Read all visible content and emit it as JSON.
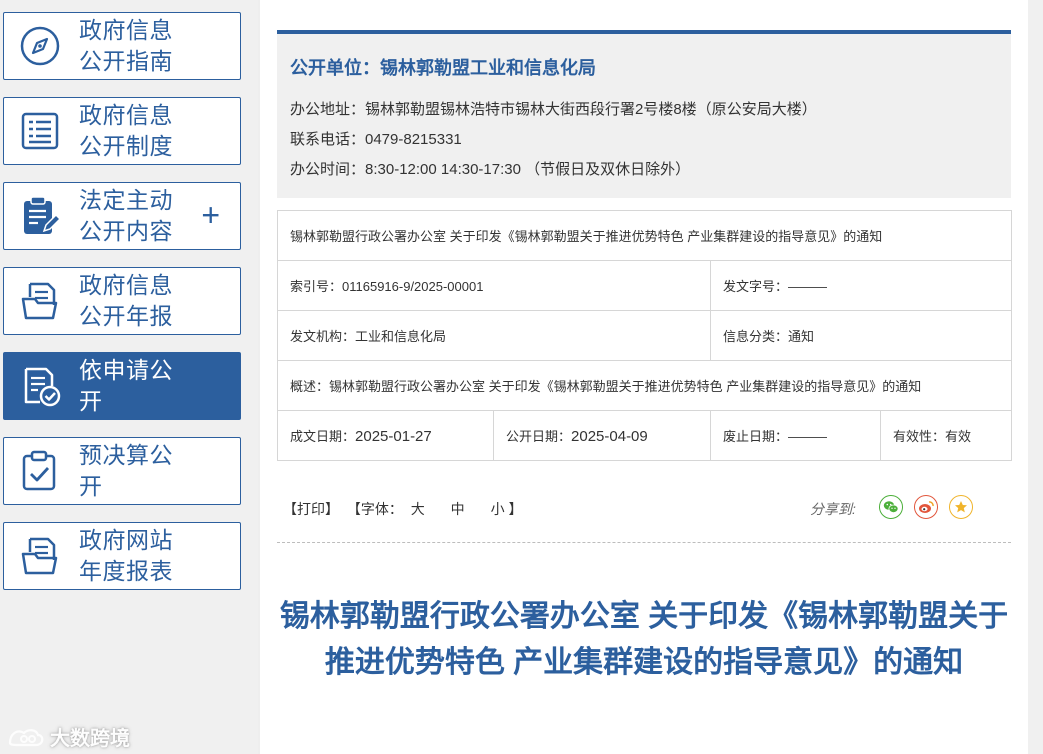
{
  "sidebar": {
    "items": [
      {
        "line1": "政府信息",
        "line2": "公开指南",
        "icon": "compass-icon"
      },
      {
        "line1": "政府信息",
        "line2": "公开制度",
        "icon": "list-document-icon"
      },
      {
        "line1": "法定主动",
        "line2": "公开内容",
        "icon": "clipboard-edit-icon",
        "expand": "+"
      },
      {
        "line1": "政府信息",
        "line2": "公开年报",
        "icon": "folder-document-icon"
      },
      {
        "line1": "依申请公",
        "line2": "开",
        "icon": "document-check-icon"
      },
      {
        "line1": "预决算公",
        "line2": "开",
        "icon": "clipboard-check-icon"
      },
      {
        "line1": "政府网站",
        "line2": "年度报表",
        "icon": "folder-document-icon"
      }
    ]
  },
  "unit": {
    "title": "公开单位：锡林郭勒盟工业和信息化局",
    "address": "办公地址：锡林郭勒盟锡林浩特市锡林大街西段行署2号楼8楼（原公安局大楼）",
    "phone": "联系电话：0479-8215331",
    "hours": "办公时间：8:30-12:00 14:30-17:30 （节假日及双休日除外）"
  },
  "meta": {
    "title_row": "锡林郭勒盟行政公署办公室 关于印发《锡林郭勒盟关于推进优势特色 产业集群建设的指导意见》的通知",
    "index_label": "索引号：",
    "index_value": "01165916-9/2025-00001",
    "docno_label": "发文字号：",
    "docno_value": "———",
    "issuer_label": "发文机构：",
    "issuer_value": "工业和信息化局",
    "category_label": "信息分类：",
    "category_value": "通知",
    "summary": "概述：锡林郭勒盟行政公署办公室 关于印发《锡林郭勒盟关于推进优势特色 产业集群建设的指导意见》的通知",
    "created_label": "成文日期：",
    "created_value": "2025-01-27",
    "published_label": "公开日期：",
    "published_value": "2025-04-09",
    "expired_label": "废止日期：",
    "expired_value": "———",
    "validity_label": "有效性：",
    "validity_value": "有效"
  },
  "toolbar": {
    "print": "【打印】",
    "font_prefix": "【字体：",
    "font_large": "大",
    "font_medium": "中",
    "font_small": "小",
    "font_suffix": "】",
    "share_label": "分享到:",
    "share_icons": [
      "wechat-icon",
      "weibo-icon",
      "favorite-star-icon"
    ],
    "share_colors": [
      "#4caf3a",
      "#e2563c",
      "#f0b42c"
    ]
  },
  "document": {
    "title": "锡林郭勒盟行政公署办公室 关于印发《锡林郭勒盟关于推进优势特色 产业集群建设的指导意见》的通知"
  },
  "watermark": {
    "text": "大数跨境"
  },
  "colors": {
    "accent": "#2c5f9e",
    "sidebar_bg": "#f0f0f0",
    "info_bg": "#f0f0f0"
  }
}
